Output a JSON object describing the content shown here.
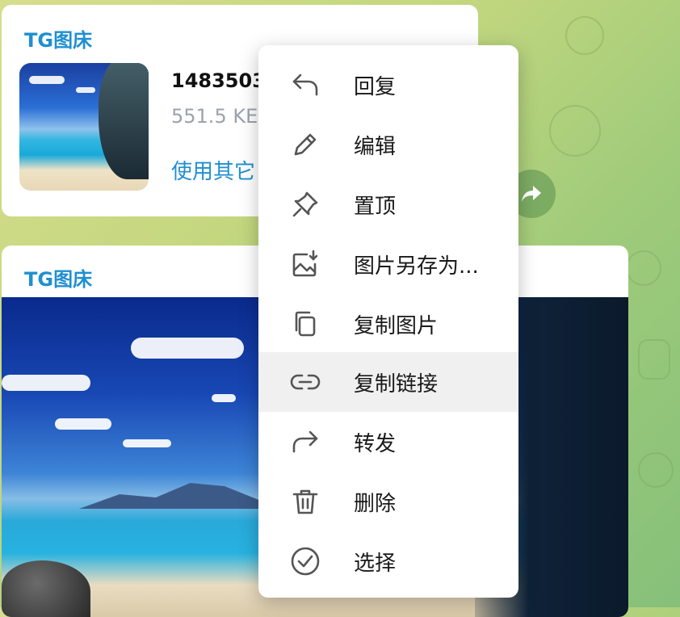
{
  "messages": [
    {
      "sender": "TG图床",
      "file_name": "1483503",
      "file_size": "551.5 KE",
      "link_text": "使用其它"
    },
    {
      "sender": "TG图床"
    }
  ],
  "context_menu": {
    "items": [
      {
        "label": "回复",
        "icon": "reply-icon"
      },
      {
        "label": "编辑",
        "icon": "pencil-icon"
      },
      {
        "label": "置顶",
        "icon": "pin-icon"
      },
      {
        "label": "图片另存为...",
        "icon": "save-image-icon"
      },
      {
        "label": "复制图片",
        "icon": "copy-icon"
      },
      {
        "label": "复制链接",
        "icon": "link-icon"
      },
      {
        "label": "转发",
        "icon": "forward-icon"
      },
      {
        "label": "删除",
        "icon": "trash-icon"
      },
      {
        "label": "选择",
        "icon": "check-circle-icon"
      }
    ],
    "highlighted_item": "复制链接"
  },
  "colors": {
    "accent": "#1f8fd0",
    "menu_highlight": "#f0f0f0",
    "background": "#c4d77f"
  }
}
